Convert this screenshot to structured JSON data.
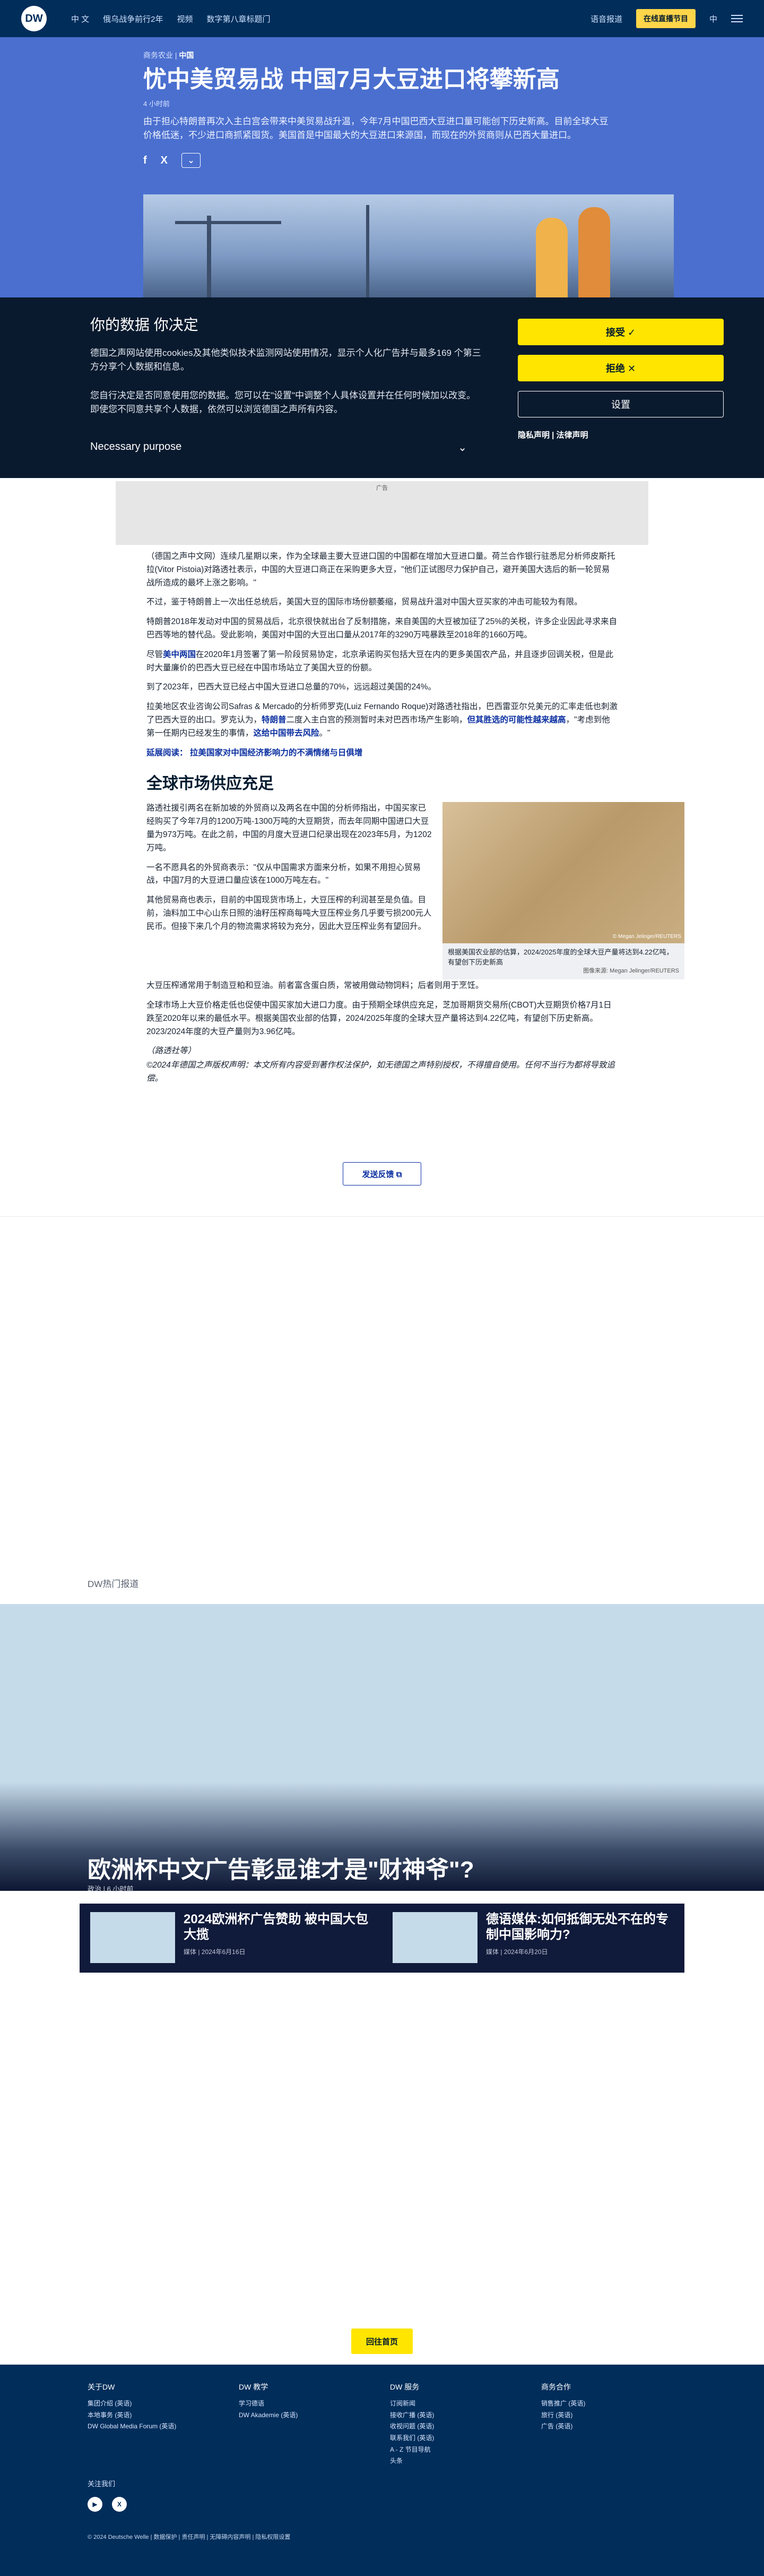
{
  "nav": {
    "logo": "DW",
    "links": [
      "中 文",
      "俄乌战争前行2年",
      "视频",
      "数字第八章标题门"
    ],
    "login": "语音报道",
    "live": "在线直播节目",
    "lang": "中"
  },
  "hero": {
    "kicker_prefix": "商务农业 |",
    "kicker_topic": "中国",
    "headline": "忧中美贸易战 中国7月大豆进口将攀新高",
    "time": "4 小时前",
    "lead": "由于担心特朗普再次入主白宫会带来中美贸易战升温，今年7月中国巴西大豆进口量可能创下历史新高。目前全球大豆价格低迷，不少进口商抓紧囤货。美国首是中国最大的大豆进口来源国，而现在的外贸商则从巴西大量进口。",
    "share_fb": "f",
    "share_x": "X",
    "share_more": "⌄"
  },
  "consent": {
    "title": "你的数据 你决定",
    "p1": "德国之声网站使用cookies及其他类似技术监测网站使用情况，显示个人化广告并与最多169 个第三方分享个人数据和信息。",
    "p2": "您自行决定是否同意使用您的数据。您可以在\"设置\"中调整个人具体设置并在任何时候加以改变。即使您不同意共享个人数据，依然可以浏览德国之声所有内容。",
    "purpose": "Necessary purpose",
    "accept": "接受 ✓",
    "reject": "拒绝 ✕",
    "settings": "设置",
    "links": "隐私声明 | 法律声明"
  },
  "ad": {
    "label": "广告"
  },
  "article": {
    "p1": "（德国之声中文网）连续几星期以来，作为全球最主要大豆进口国的中国都在增加大豆进口量。荷兰合作银行驻悉尼分析师皮斯托拉(Vitor Pistoia)对路透社表示，中国的大豆进口商正在采购更多大豆，\"他们正试图尽力保护自己，避开美国大选后的新一轮贸易战所造成的最坏上涨之影响。\"",
    "p2": "不过，鉴于特朗普上一次出任总统后，美国大豆的国际市场份额萎缩，贸易战升温对中国大豆买家的冲击可能较为有限。",
    "p3": "特朗普2018年发动对中国的贸易战后，北京很快就出台了反制措施，来自美国的大豆被加征了25%的关税，许多企业因此寻求来自巴西等地的替代品。受此影响，美国对中国的大豆出口量从2017年的3290万吨暴跌至2018年的1660万吨。",
    "p4a": "尽管",
    "p4link": "美中两国",
    "p4b": "在2020年1月签署了第一阶段贸易协定，北京承诺购买包括大豆在内的更多美国农产品，并且逐步回调关税，但是此时大量廉价的巴西大豆已经在中国市场站立了美国大豆的份额。",
    "p5": "到了2023年，巴西大豆已经占中国大豆进口总量的70%，远远超过美国的24%。",
    "p6a": "拉美地区农业咨询公司Safras & Mercado的分析师罗克(Luiz Fernando Roque)对路透社指出，巴西雷亚尔兑美元的汇率走低也刺激了巴西大豆的出口。罗克认为，",
    "p6link1": "特朗普",
    "p6b": "二度入主白宫的预测暂时未对巴西市场产生影响，",
    "p6link2": "但其胜选的可能性越来越高",
    "p6c": "，\"考虑到他第一任期内已经发生的事情，",
    "p6link3": "这给中国带去风险",
    "p6d": "。\"",
    "more_prefix": "延展阅读：",
    "more_link": "拉美国家对中国经济影响力的不满情绪与日俱增",
    "sub": "全球市场供应充足",
    "c1": "路透社援引两名在新加坡的外贸商以及两名在中国的分析师指出，中国买家已经购买了今年7月的1200万吨-1300万吨的大豆期货，而去年同期中国进口大豆量为973万吨。在此之前，中国的月度大豆进口纪录出现在2023年5月，为1202万吨。",
    "c2": "一名不愿具名的外贸商表示：\"仅从中国需求方面来分析，如果不用担心贸易战，中国7月的大豆进口量应该在1000万吨左右。\"",
    "c3": "其他贸易商也表示，目前的中国现货市场上，大豆压榨的利润甚至是负值。目前，油料加工中心山东日照的油籽压榨商每吨大豆压榨业务几乎要亏损200元人民币。但接下来几个月的物流需求将较为充分，因此大豆压榨业务有望回升。",
    "fig_caption": "根据美国农业部的估算，2024/2025年度的全球大豆产量将达到4.22亿吨，有望创下历史新高",
    "fig_credit": "图像来源: Megan Jelinger/REUTERS",
    "fig_wm": "© Megan Jelinger/REUTERS",
    "p7": "大豆压榨通常用于制造豆粕和豆油。前者富含蛋白质，常被用做动物饲料；后者则用于烹饪。",
    "p8": "全球市场上大豆价格走低也促使中国买家加大进口力度。由于预期全球供应充足，芝加哥期货交易所(CBOT)大豆期货价格7月1日跌至2020年以来的最低水平。根据美国农业部的估算，2024/2025年度的全球大豆产量将达到4.22亿吨，有望创下历史新高。2023/2024年度的大豆产量则为3.96亿吨。",
    "src": "（路透社等）",
    "copyright": "©2024年德国之声版权声明：本文所有内容受到著作权法保护，如无德国之声特别授权，不得擅自使用。任何不当行为都将导致追偿。",
    "feedback": "发送反馈 ⧉"
  },
  "popular": {
    "label": "DW热门报道",
    "title": "欧洲杯中文广告彰显谁才是\"财神爷\"?",
    "meta": "政治 | 6 小时前",
    "cards": [
      {
        "title": "2024欧洲杯广告赞助 被中国大包大揽",
        "meta": "媒体 | 2024年6月16日"
      },
      {
        "title": "德语媒体:如何抵御无处不在的专制中国影响力?",
        "meta": "媒体 | 2024年6月20日"
      }
    ]
  },
  "home_button": "回往首页",
  "footer": {
    "cols": [
      {
        "title": "关于DW",
        "items": [
          "集团介绍 (英语)",
          "本地事务 (英语)",
          "DW Global Media Forum (英语)"
        ]
      },
      {
        "title": "DW 教学",
        "items": [
          "学习德语",
          "DW Akademie (英语)"
        ]
      },
      {
        "title": "DW 服务",
        "items": [
          "订阅新闻",
          "接收广播 (英语)",
          "收视问题 (英语)",
          "联系我们 (英语)",
          "A - Z 节目导航",
          "头条"
        ]
      },
      {
        "title": "商务合作",
        "items": [
          "销售推广 (英语)",
          "旅行 (英语)",
          "广告 (英语)"
        ]
      }
    ],
    "follow": "关注我们",
    "social": [
      "▶",
      "X"
    ],
    "bottom": "© 2024 Deutsche Welle  |  数据保护  |  责任声明  |  无障碍内容声明  |  隐私权限设置"
  }
}
